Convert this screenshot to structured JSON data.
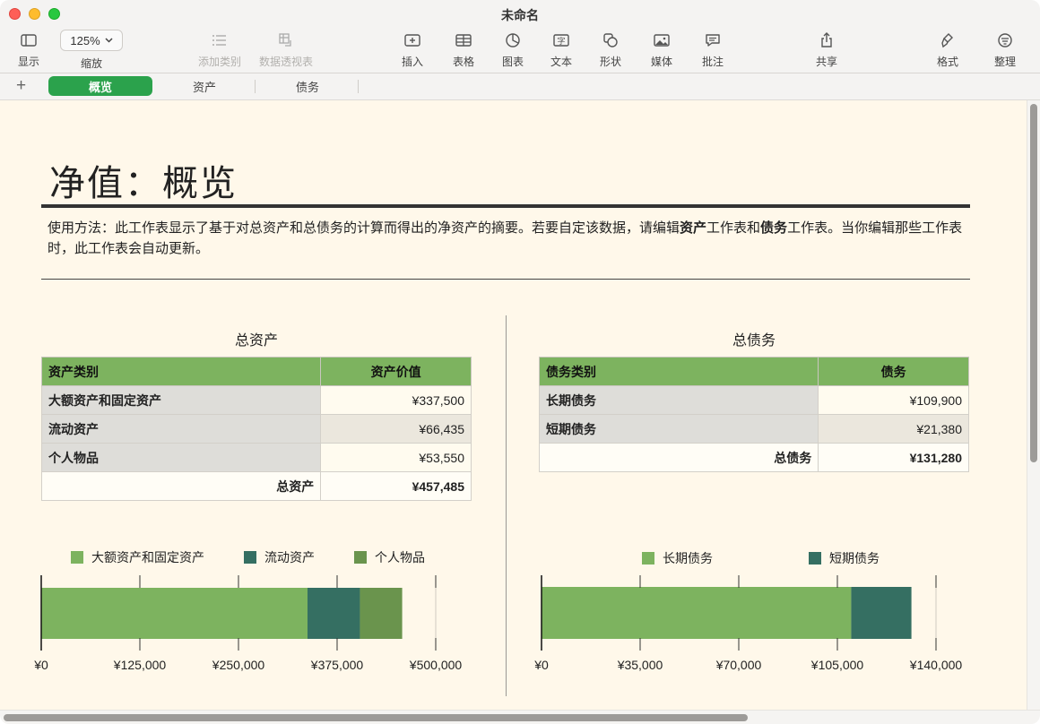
{
  "window": {
    "title": "未命名"
  },
  "toolbar": {
    "view_label": "显示",
    "zoom_value": "125%",
    "zoom_label": "缩放",
    "add_category_label": "添加类别",
    "pivot_label": "数据透视表",
    "insert_label": "插入",
    "table_label": "表格",
    "chart_label": "图表",
    "text_label": "文本",
    "shape_label": "形状",
    "media_label": "媒体",
    "comment_label": "批注",
    "share_label": "共享",
    "format_label": "格式",
    "organize_label": "整理"
  },
  "tabs": [
    {
      "label": "概览",
      "active": true
    },
    {
      "label": "资产",
      "active": false
    },
    {
      "label": "债务",
      "active": false
    }
  ],
  "page": {
    "title": "净值：概览",
    "intro_pre": "使用方法：此工作表显示了基于对总资产和总债务的计算而得出的净资产的摘要。若要自定该数据，请编辑",
    "intro_b1": "资产",
    "intro_mid": "工作表和",
    "intro_b2": "债务",
    "intro_post": "工作表。当你编辑那些工作表时，此工作表会自动更新。"
  },
  "assets": {
    "title": "总资产",
    "col_category": "资产类别",
    "col_value": "资产价值",
    "rows": [
      {
        "category": "大额资产和固定资产",
        "value": "¥337,500"
      },
      {
        "category": "流动资产",
        "value": "¥66,435"
      },
      {
        "category": "个人物品",
        "value": "¥53,550"
      }
    ],
    "total_label": "总资产",
    "total_value": "¥457,485"
  },
  "debts": {
    "title": "总债务",
    "col_category": "债务类别",
    "col_value": "债务",
    "rows": [
      {
        "category": "长期债务",
        "value": "¥109,900"
      },
      {
        "category": "短期债务",
        "value": "¥21,380"
      }
    ],
    "total_label": "总债务",
    "total_value": "¥131,280"
  },
  "colors": {
    "light_green": "#7db35f",
    "teal": "#356f62",
    "olive": "#6a944d",
    "accent_tab": "#2ba24c"
  },
  "chart_data": [
    {
      "type": "bar",
      "orientation": "horizontal",
      "stacked": true,
      "title": "",
      "categories": [
        ""
      ],
      "series": [
        {
          "name": "大额资产和固定资产",
          "values": [
            337500
          ],
          "color": "#7db35f"
        },
        {
          "name": "流动资产",
          "values": [
            66435
          ],
          "color": "#356f62"
        },
        {
          "name": "个人物品",
          "values": [
            53550
          ],
          "color": "#6a944d"
        }
      ],
      "xlim": [
        0,
        500000
      ],
      "tick_values": [
        0,
        125000,
        250000,
        375000,
        500000
      ],
      "tick_labels": [
        "¥0",
        "¥125,000",
        "¥250,000",
        "¥375,000",
        "¥500,000"
      ],
      "legend_position": "top",
      "grid": true
    },
    {
      "type": "bar",
      "orientation": "horizontal",
      "stacked": true,
      "title": "",
      "categories": [
        ""
      ],
      "series": [
        {
          "name": "长期债务",
          "values": [
            109900
          ],
          "color": "#7db35f"
        },
        {
          "name": "短期债务",
          "values": [
            21380
          ],
          "color": "#356f62"
        }
      ],
      "xlim": [
        0,
        140000
      ],
      "tick_values": [
        0,
        35000,
        70000,
        105000,
        140000
      ],
      "tick_labels": [
        "¥0",
        "¥35,000",
        "¥70,000",
        "¥105,000",
        "¥140,000"
      ],
      "legend_position": "top",
      "grid": true
    }
  ]
}
